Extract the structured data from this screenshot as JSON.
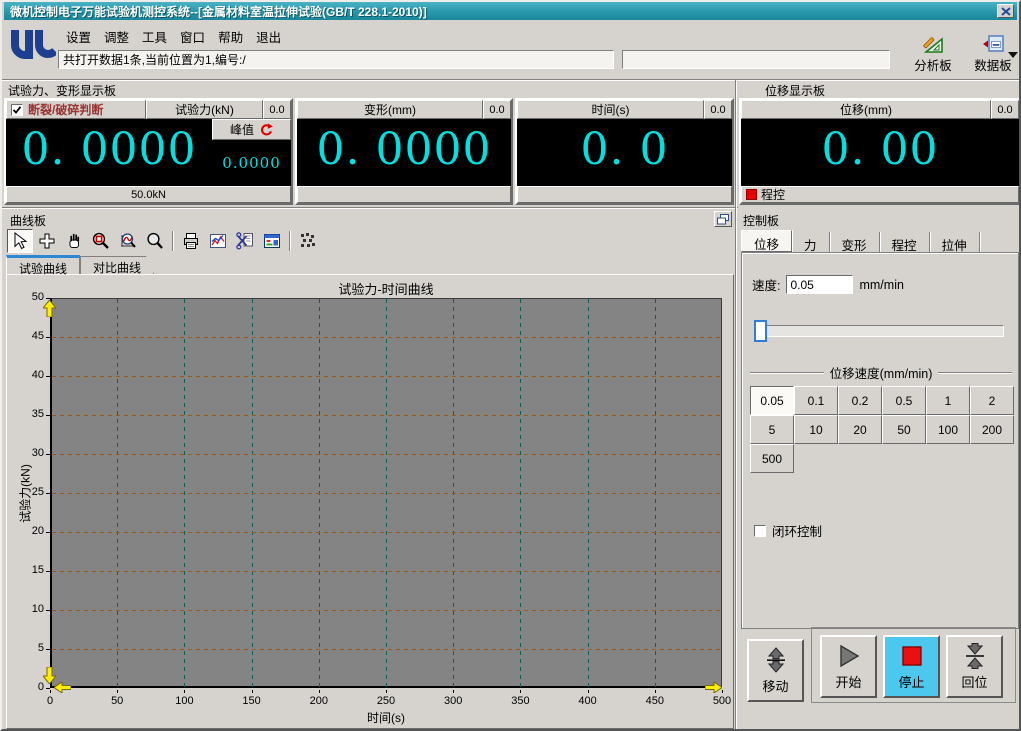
{
  "window": {
    "title": "微机控制电子万能试验机测控系统--[金属材料室温拉伸试验(GB/T 228.1-2010)]"
  },
  "menu": {
    "items": [
      "设置",
      "调整",
      "工具",
      "窗口",
      "帮助",
      "退出"
    ]
  },
  "statusbar": {
    "text": "共打开数据1条,当前位置为1,编号:/"
  },
  "header_tools": {
    "analyze_label": "分析板",
    "data_label": "数据板"
  },
  "display_panels": {
    "group_title_left": "试验力、变形显示板",
    "group_title_right": "位移显示板",
    "force": {
      "break_check_label": "断裂/破碎判断",
      "break_checked": true,
      "unit_label": "试验力(kN)",
      "rate": "0.0",
      "value": "0. 0000",
      "peak_label": "峰值",
      "peak_value": "0.0000",
      "range": "50.0kN"
    },
    "deform": {
      "unit_label": "变形(mm)",
      "rate": "0.0",
      "value": "0. 0000"
    },
    "time": {
      "unit_label": "时间(s)",
      "rate": "0.0",
      "value": "0. 0"
    },
    "displacement": {
      "unit_label": "位移(mm)",
      "rate": "0.0",
      "value": "0. 00",
      "status_label": "程控"
    }
  },
  "curve_panel": {
    "title": "曲线板",
    "tabs": [
      "试验曲线",
      "对比曲线"
    ],
    "active_tab": "试验曲线",
    "toolbar_icons": [
      "select-cursor",
      "move-crosshair",
      "pan-hand",
      "zoom-box",
      "zoom-curve",
      "magnifier",
      "print",
      "curve-view",
      "snip-export",
      "data-panel",
      "pattern-grid"
    ]
  },
  "chart_data": {
    "type": "line",
    "title": "试验力-时间曲线",
    "xlabel": "时间(s)",
    "ylabel": "试验力(kN)",
    "xlim": [
      0,
      500
    ],
    "xtick_step": 50,
    "ylim": [
      0,
      50
    ],
    "ytick_step": 5,
    "grid": true,
    "legend": "none",
    "plot_bg": "#848484",
    "hgrid_color": "#9a5a1e",
    "vgrid_color": "#0e6054",
    "series": [
      {
        "name": "试验力-时间",
        "x": [],
        "y": []
      }
    ]
  },
  "control_panel": {
    "title": "控制板",
    "tabs": [
      "位移",
      "力",
      "变形",
      "程控",
      "拉伸"
    ],
    "active_tab": "位移",
    "speed_label": "速度:",
    "speed_value": "0.05",
    "speed_unit": "mm/min",
    "speed_group_label": "位移速度(mm/min)",
    "speed_options": [
      "0.05",
      "0.1",
      "0.2",
      "0.5",
      "1",
      "2",
      "5",
      "10",
      "20",
      "50",
      "100",
      "200",
      "500"
    ],
    "selected_speed": "0.05",
    "closed_loop_label": "闭环控制",
    "closed_loop_checked": false,
    "action_buttons": {
      "move": "移动",
      "start": "开始",
      "stop": "停止",
      "home": "回位"
    }
  },
  "colors": {
    "titlebar": "#2797ac",
    "display_bg": "#000000",
    "display_text": "#00e0e0",
    "break_label": "#993333",
    "stop_button_bg": "#4cc8ee",
    "axis_arrow": "#ffee00",
    "selected_tab_accent": "#2f86d2"
  }
}
